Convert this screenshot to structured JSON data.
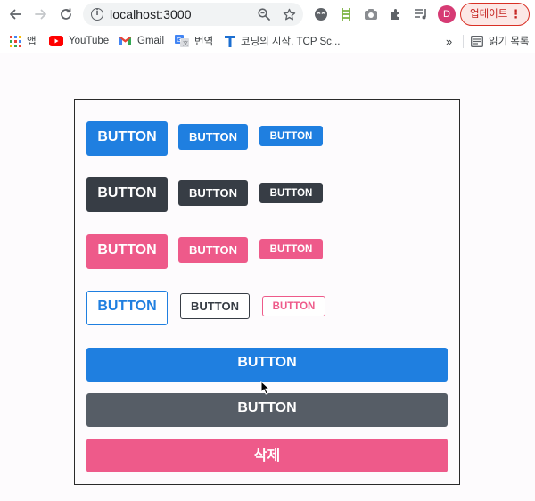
{
  "browser": {
    "url": "localhost:3000",
    "avatar_letter": "D",
    "update_label": "업데이트",
    "menu_glyph": "⋮",
    "bookmarks": [
      {
        "label": "앱",
        "icon": "apps-grid-icon"
      },
      {
        "label": "YouTube",
        "icon": "youtube-icon"
      },
      {
        "label": "Gmail",
        "icon": "gmail-icon"
      },
      {
        "label": "번역",
        "icon": "translate-icon"
      },
      {
        "label": "코딩의 시작, TCP Sc...",
        "icon": "tcp-school-icon"
      }
    ],
    "overflow_glyph": "»",
    "reading_list_label": "읽기 목록"
  },
  "buttons": {
    "blue_large": "BUTTON",
    "blue_medium": "BUTTON",
    "blue_small": "BUTTON",
    "dark_large": "BUTTON",
    "dark_medium": "BUTTON",
    "dark_small": "BUTTON",
    "pink_large": "BUTTON",
    "pink_medium": "BUTTON",
    "pink_small": "BUTTON",
    "outline_blue_large": "BUTTON",
    "outline_dark_medium": "BUTTON",
    "outline_pink_small": "BUTTON",
    "full_blue": "BUTTON",
    "full_gray": "BUTTON",
    "full_pink": "삭제"
  },
  "colors": {
    "blue": "#1f7fe0",
    "dark": "#373d45",
    "pink": "#ee5a8a",
    "gray": "#565d66"
  }
}
